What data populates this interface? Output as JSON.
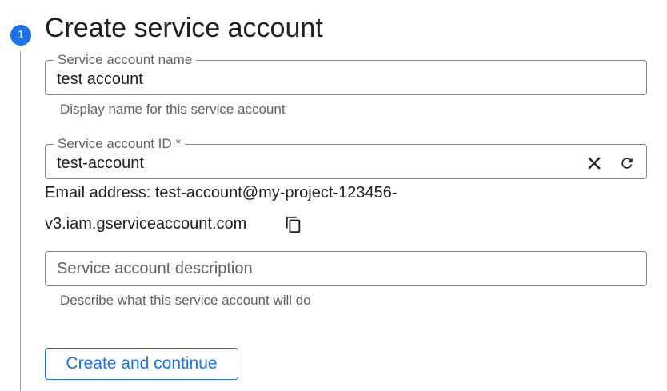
{
  "step": {
    "number": "1",
    "title": "Create service account"
  },
  "name_field": {
    "label": "Service account name",
    "value": "test account",
    "hint": "Display name for this service account"
  },
  "id_field": {
    "label": "Service account ID *",
    "value": "test-account",
    "clear_icon": "close-icon",
    "refresh_icon": "refresh-icon"
  },
  "email": {
    "line1": "Email address: test-account@my-project-123456-",
    "line2": "v3.iam.gserviceaccount.com",
    "copy_icon": "copy-icon"
  },
  "description_field": {
    "placeholder": "Service account description",
    "hint": "Describe what this service account will do"
  },
  "actions": {
    "create_label": "Create and continue"
  },
  "colors": {
    "accent": "#1a73e8",
    "border": "#80868b",
    "secondary_text": "#5f6368"
  }
}
